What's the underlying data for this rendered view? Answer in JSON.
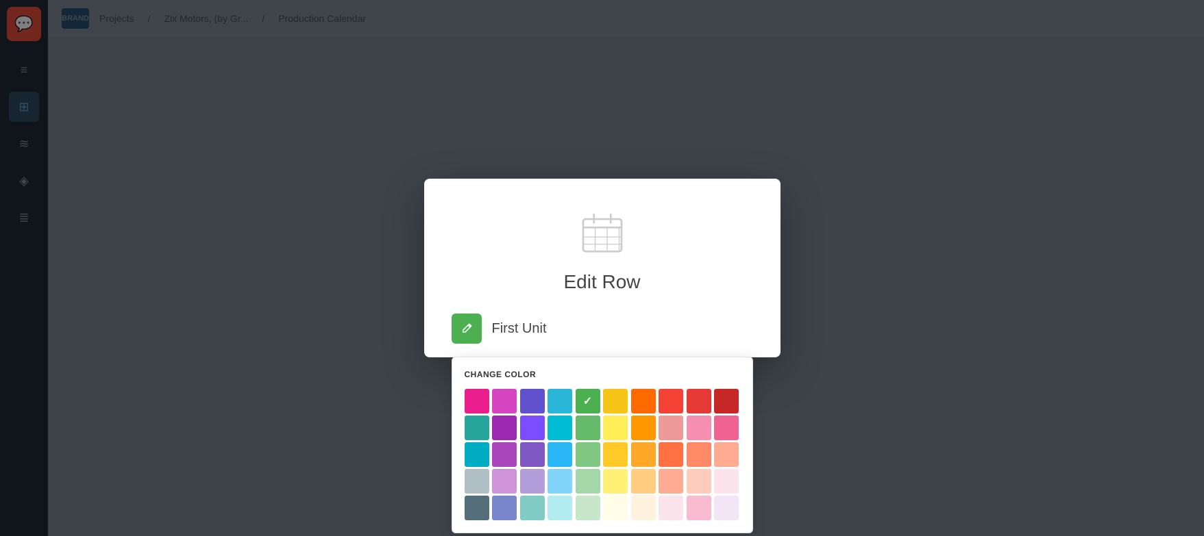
{
  "app": {
    "title": "Production Calendar"
  },
  "sidebar": {
    "logo_text": "💬",
    "icons": [
      "≡",
      "⊞",
      "≋",
      "◈",
      "⟳"
    ]
  },
  "topbar": {
    "brand": "BRAND",
    "nav_items": [
      "Projects",
      "Zix Motors, (by Gr...",
      "...",
      "Production Calendar"
    ]
  },
  "modal": {
    "title": "Edit Row",
    "calendar_icon": "calendar",
    "row_name": "First Unit",
    "row_color": "#4caf50",
    "color_picker": {
      "label": "CHANGE COLOR",
      "colors": [
        [
          "#e91e8c",
          "#d84fbb",
          "#6251cc",
          "#29b6d9",
          "#4caf50",
          "#f5c518",
          "#ff6a00",
          "#f44336"
        ],
        [
          "#4db6ac",
          "#9c27b0",
          "#7c4dff",
          "#00bcd4",
          "#66bb6a",
          "#ffee58",
          "#ff9800",
          "#ef9a9a"
        ],
        [
          "#26c6da",
          "#ab47bc",
          "#7e57c2",
          "#26c6da",
          "#81c784",
          "#ffca28",
          "#ffa726",
          "#ff7043"
        ],
        [
          "#b0bec5",
          "#ce93d8",
          "#b39ddb",
          "#81d4fa",
          "#a5d6a7",
          "#fff176",
          "#ffcc80",
          "#ffab91"
        ],
        [
          "#546e7a",
          "#7986cb",
          "#80cbc4",
          "#b2ebf2",
          "#c8e6c9",
          "#fffde7",
          "#fff3e0",
          "#fce4ec"
        ]
      ],
      "selected_color": "#4caf50"
    }
  },
  "colors": {
    "row1": [
      "#e91e8c",
      "#d84fbb",
      "#6251cc",
      "#29b6d9",
      "#4caf50",
      "#f5c518",
      "#ff6a00",
      "#f44336",
      "#e53935",
      "#c62828"
    ],
    "row2": [
      "#4db6ac",
      "#9c27b0",
      "#7c4dff",
      "#00bcd4",
      "#66bb6a",
      "#ffee58",
      "#ff9800",
      "#ef9a9a",
      "#f48fb1",
      "#f06292"
    ],
    "row3": [
      "#26c6da",
      "#ab47bc",
      "#7e57c2",
      "#26c6da",
      "#81c784",
      "#ffca28",
      "#ffa726",
      "#ff7043",
      "#ff8a65",
      "#ffab91"
    ],
    "row4": [
      "#b0bec5",
      "#ce93d8",
      "#b39ddb",
      "#81d4fa",
      "#a5d6a7",
      "#fff176",
      "#ffcc80",
      "#ffab91",
      "#ff8a65",
      "#ef9a9a"
    ],
    "row5": [
      "#546e7a",
      "#7986cb",
      "#80cbc4",
      "#b2ebf2",
      "#c8e6c9",
      "#fffde7",
      "#fff3e0",
      "#fce4ec",
      "#f8bbd0",
      "#f3e5f5"
    ]
  }
}
